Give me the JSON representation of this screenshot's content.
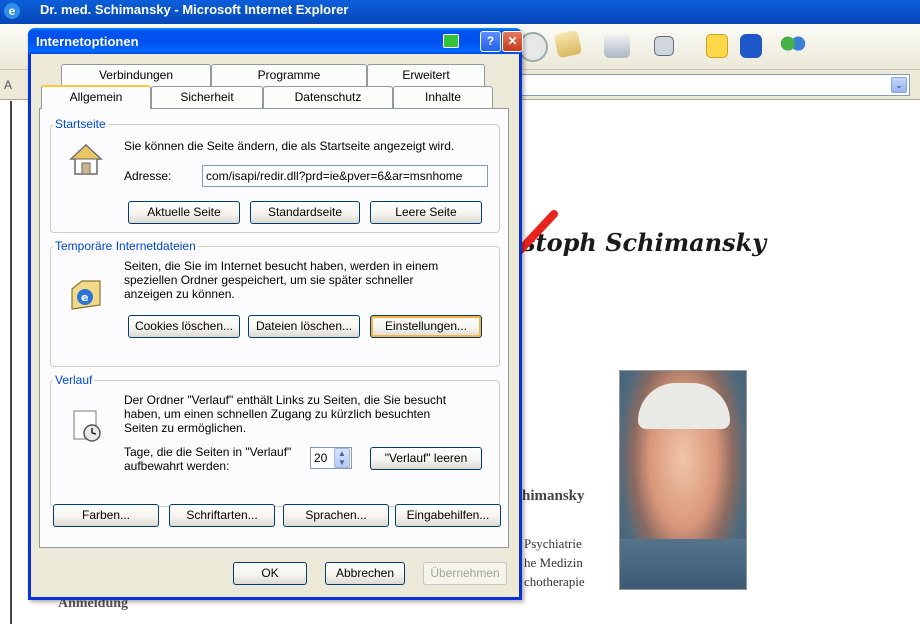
{
  "browser": {
    "title": "Dr. med. Schimansky - Microsoft Internet Explorer",
    "address_label": "A",
    "dropdown_glyph": "⌄"
  },
  "page": {
    "heading_fragment": "stoph Schimansky",
    "name_fragment": "himansky",
    "line1": "Psychiatrie",
    "line2": "he Medizin",
    "line3": "chotherapie",
    "anmeldung": "Anmeldung"
  },
  "dialog": {
    "title": "Internetoptionen",
    "help_glyph": "?",
    "close_glyph": "✕",
    "tabs_row1": [
      "Verbindungen",
      "Programme",
      "Erweitert"
    ],
    "tabs_row2": [
      "Allgemein",
      "Sicherheit",
      "Datenschutz",
      "Inhalte"
    ],
    "selected_tab": "Allgemein",
    "startseite": {
      "legend": "Startseite",
      "desc": "Sie können die Seite ändern, die als Startseite angezeigt wird.",
      "address_label": "Adresse:",
      "address_value": "com/isapi/redir.dll?prd=ie&pver=6&ar=msnhome",
      "btn_current": "Aktuelle Seite",
      "btn_default": "Standardseite",
      "btn_blank": "Leere Seite"
    },
    "temp_files": {
      "legend": "Temporäre Internetdateien",
      "desc_1": "Seiten, die Sie im Internet besucht haben, werden in einem",
      "desc_2": "speziellen Ordner gespeichert, um sie später schneller",
      "desc_3": "anzeigen zu können.",
      "btn_cookies": "Cookies löschen...",
      "btn_files": "Dateien löschen...",
      "btn_settings": "Einstellungen..."
    },
    "history": {
      "legend": "Verlauf",
      "desc_1": "Der Ordner \"Verlauf\" enthält Links zu Seiten, die Sie besucht",
      "desc_2": "haben, um einen schnellen Zugang zu kürzlich besuchten",
      "desc_3": "Seiten zu ermöglichen.",
      "days_label_1": "Tage, die die Seiten in \"Verlauf\"",
      "days_label_2": "aufbewahrt werden:",
      "days_value": "20",
      "btn_clear": "\"Verlauf\" leeren"
    },
    "bottom_buttons": {
      "colors": "Farben...",
      "fonts": "Schriftarten...",
      "languages": "Sprachen...",
      "accessibility": "Eingabehilfen..."
    },
    "ok": "OK",
    "cancel": "Abbrechen",
    "apply": "Übernehmen"
  },
  "colors": {
    "dialog_border": "#0831d9",
    "legend": "#0046d5",
    "arrow": "#e8231c"
  }
}
